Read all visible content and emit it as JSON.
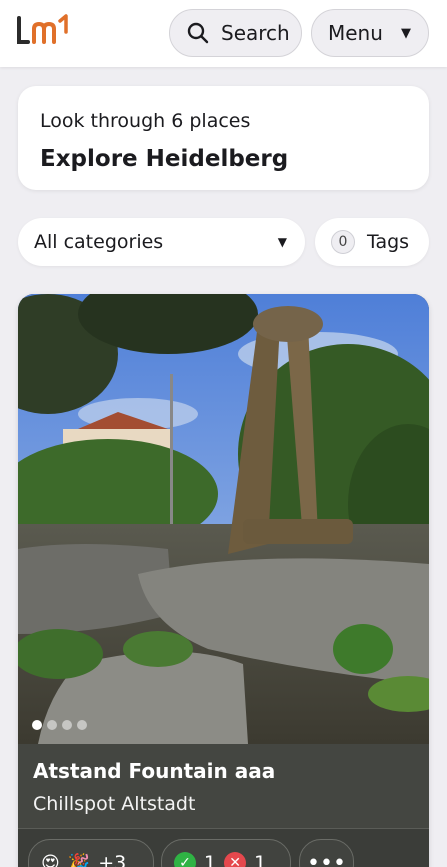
{
  "header": {
    "logo_text": "lm",
    "search_label": "Search",
    "menu_label": "Menu"
  },
  "intro": {
    "subtitle": "Look through 6 places",
    "title": "Explore Heidelberg"
  },
  "filters": {
    "category_value": "All categories",
    "tags_count": "0",
    "tags_label": "Tags"
  },
  "place": {
    "name": "Atstand Fountain aaa",
    "category": "Chillspot Altstadt",
    "photo_count": 4,
    "active_photo": 1,
    "reactions": {
      "emoji_1": "😍",
      "emoji_2": "🎉",
      "more": "+3"
    },
    "votes": {
      "yes": "1",
      "no": "1"
    },
    "more_label": "•••"
  },
  "colors": {
    "accent": "#e0702a",
    "background": "#efeef2",
    "card_info": "#444641"
  }
}
